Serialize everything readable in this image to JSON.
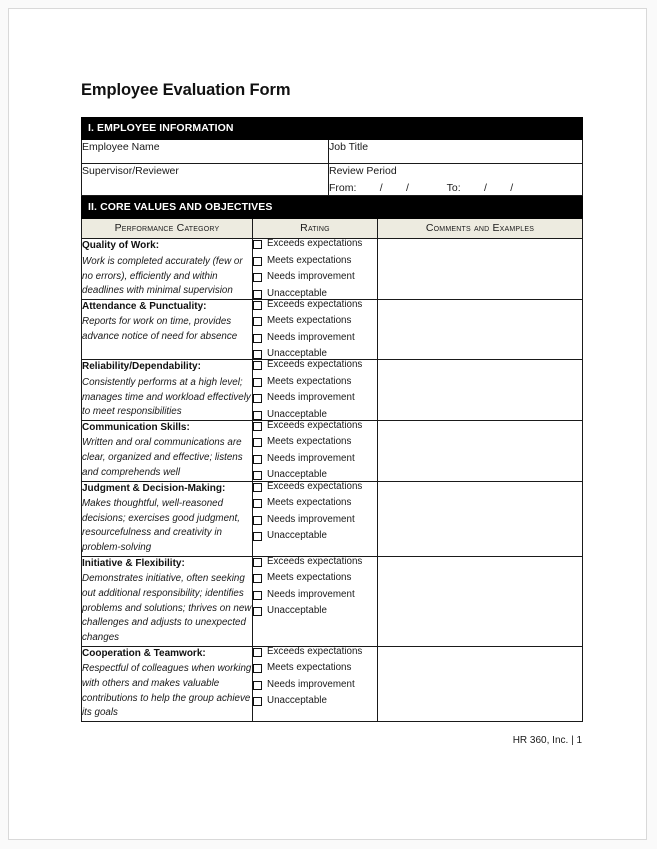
{
  "document": {
    "title": "Employee Evaluation Form",
    "footer": "HR 360, Inc. | 1"
  },
  "colors": {
    "section_bar_bg": "#000000",
    "section_bar_text": "#ffffff",
    "column_header_bg": "#edebe0",
    "border": "#1a1a1a",
    "page_bg": "#ffffff",
    "canvas_bg": "#fafafa"
  },
  "section_one": {
    "heading": "I. EMPLOYEE INFORMATION",
    "fields": {
      "employee_name_label": "Employee Name",
      "employee_name_value": "",
      "job_title_label": "Job Title",
      "job_title_value": "",
      "supervisor_label": "Supervisor/Reviewer",
      "supervisor_value": "",
      "review_period_label": "Review Period",
      "review_period_line": "From:        /        /             To:        /        /"
    }
  },
  "section_two": {
    "heading": "II. CORE VALUES AND OBJECTIVES",
    "columns": {
      "category": "Performance Category",
      "rating": "Rating",
      "comments": "Comments and Examples"
    },
    "rating_options": [
      "Exceeds expectations",
      "Meets expectations",
      "Needs improvement",
      "Unacceptable"
    ],
    "rows": [
      {
        "title": "Quality of Work:",
        "description": "Work is completed accurately (few or no errors), efficiently and within deadlines with minimal supervision",
        "comment": ""
      },
      {
        "title": "Attendance & Punctuality:",
        "description": "Reports for work on time, provides advance notice of need for absence",
        "comment": ""
      },
      {
        "title": "Reliability/Dependability:",
        "description": "Consistently performs at a high level; manages time and workload effectively to meet responsibilities",
        "comment": ""
      },
      {
        "title": "Communication Skills:",
        "description": "Written and oral communications are clear, organized and effective; listens and comprehends well",
        "comment": ""
      },
      {
        "title": "Judgment & Decision-Making:",
        "description": "Makes thoughtful, well-reasoned decisions; exercises good judgment, resourcefulness and creativity in problem-solving",
        "comment": ""
      },
      {
        "title": "Initiative & Flexibility:",
        "description": "Demonstrates initiative, often seeking out additional responsibility; identifies problems and solutions; thrives on new challenges and adjusts to unexpected changes",
        "comment": ""
      },
      {
        "title": "Cooperation & Teamwork:",
        "description": "Respectful of colleagues when working with others and makes valuable contributions to help the group achieve its goals",
        "comment": ""
      }
    ]
  }
}
